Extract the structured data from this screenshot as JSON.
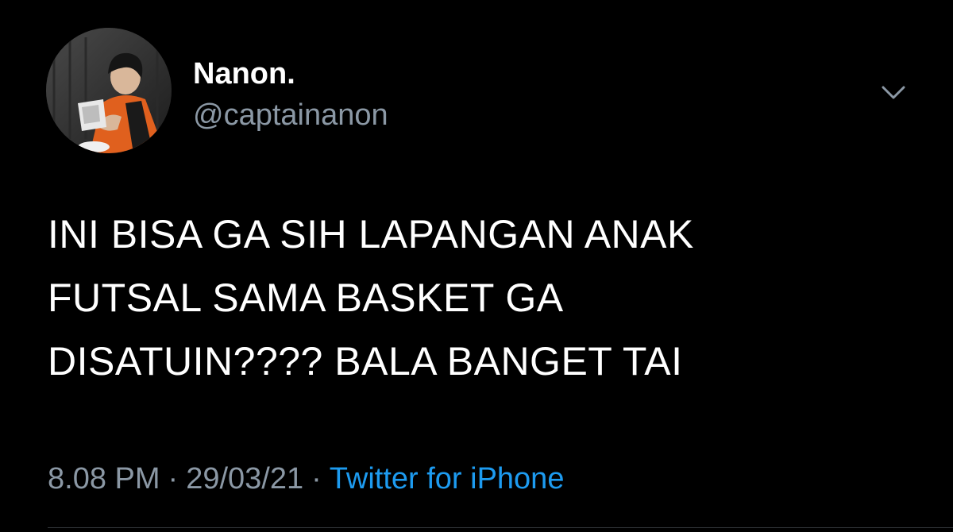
{
  "user": {
    "display_name": "Nanon.",
    "handle": "@captainanon"
  },
  "tweet": {
    "lines": [
      "INI BISA GA SIH LAPANGAN ANAK",
      "FUTSAL SAMA BASKET GA",
      "DISATUIN???? BALA BANGET TAI"
    ],
    "time": "8.08 PM",
    "date": "29/03/21",
    "separator": "·",
    "source": "Twitter for iPhone"
  },
  "icons": {
    "avatar": "profile-photo",
    "menu": "chevron-down-icon"
  },
  "colors": {
    "background": "#000000",
    "text": "#ffffff",
    "secondary": "#8b98a5",
    "link": "#1d9bf0"
  }
}
